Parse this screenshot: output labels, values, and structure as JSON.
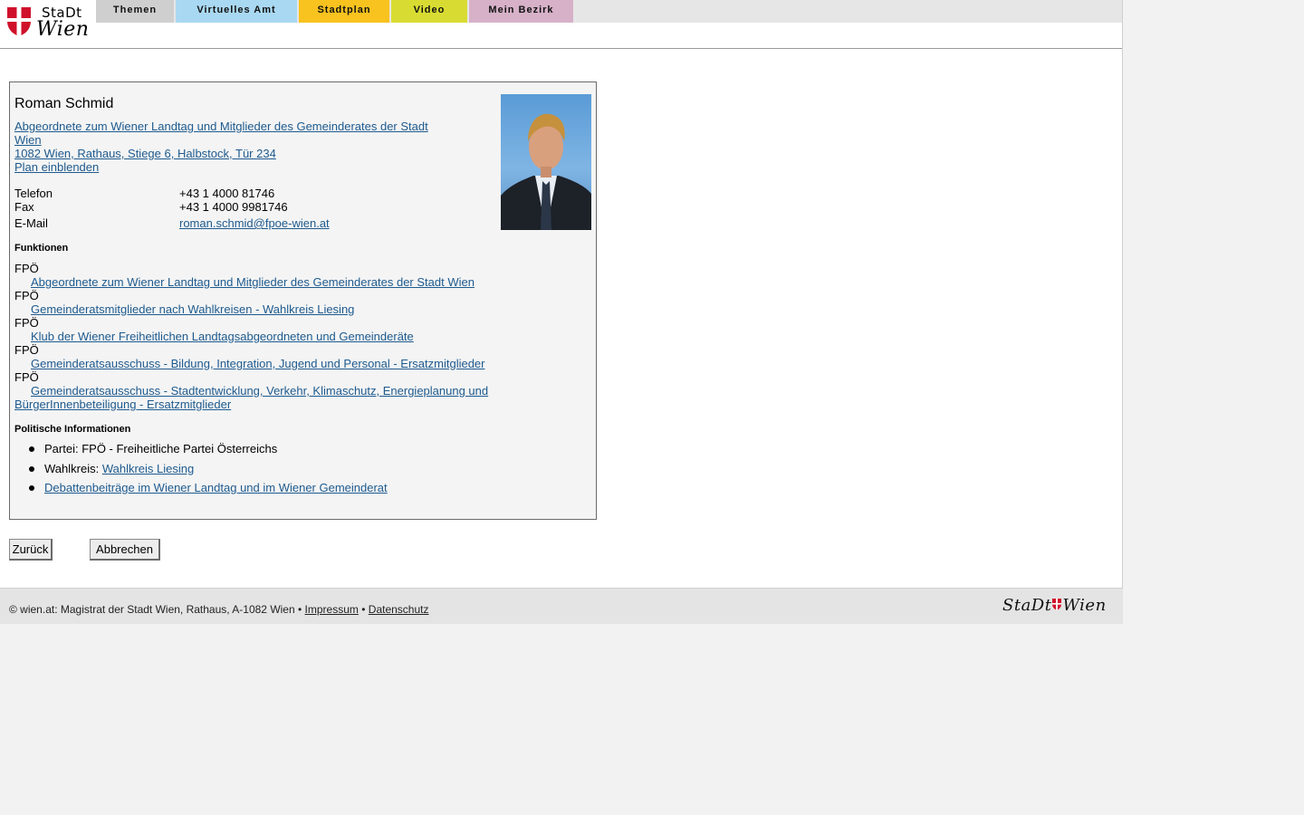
{
  "brand": {
    "line1": "StaDt",
    "line2": "Wien",
    "footer_logo_left": "StaDt",
    "footer_logo_right": "Wien"
  },
  "nav": {
    "tabs": [
      {
        "label": "Themen",
        "color": "#cfcfcf"
      },
      {
        "label": "Virtuelles Amt",
        "color": "#a9d8f2"
      },
      {
        "label": "Stadtplan",
        "color": "#f8c21f"
      },
      {
        "label": "Video",
        "color": "#d8dc32"
      },
      {
        "label": "Mein Bezirk",
        "color": "#d6b1c8"
      }
    ]
  },
  "person": {
    "name": "Roman Schmid",
    "role_line1": "Abgeordnete zum Wiener Landtag und Mitglieder des Gemeinderates der Stadt",
    "role_line2": "Wien ",
    "address": "1082 Wien, Rathaus, Stiege 6, Halbstock, Tür 234",
    "map_link": "Plan einblenden"
  },
  "contact": [
    {
      "label": "Telefon",
      "value": "+43 1 4000 81746"
    },
    {
      "label": "Fax",
      "value": "+43 1 4000 9981746"
    },
    {
      "label": "E-Mail",
      "value": "roman.schmid@fpoe-wien.at"
    }
  ],
  "functions": {
    "title": "Funktionen",
    "items": [
      {
        "party": "FPÖ",
        "text": "Abgeordnete zum Wiener Landtag und Mitglieder des Gemeinderates der Stadt Wien"
      },
      {
        "party": "FPÖ",
        "text": "Gemeinderatsmitglieder nach Wahlkreisen - Wahlkreis Liesing"
      },
      {
        "party": "FPÖ",
        "text": "Klub der Wiener Freiheitlichen Landtagsabgeordneten und Gemeinderäte"
      },
      {
        "party": "FPÖ",
        "text": "Gemeinderatsausschuss - Bildung, Integration, Jugend und Personal - Ersatzmitglieder"
      },
      {
        "party": "FPÖ",
        "text_line1": "Gemeinderatsausschuss - Stadtentwicklung, Verkehr, Klimaschutz, Energieplanung und",
        "text_line2": "BürgerInnenbeteiligung - Ersatzmitglieder"
      }
    ]
  },
  "political": {
    "title": "Politische Informationen",
    "party_label": "Partei:",
    "party_value": "FPÖ - Freiheitliche Partei Österreichs",
    "district_label": "Wahlkreis:",
    "district_link": "Wahlkreis Liesing",
    "debates_link": "Debattenbeiträge im Wiener Landtag und im Wiener Gemeinderat"
  },
  "buttons": {
    "back": "Zurück",
    "cancel": "Abbrechen"
  },
  "footer": {
    "copyright": "© wien.at: Magistrat der Stadt Wien, Rathaus, A-1082 Wien •",
    "impressum": "Impressum",
    "separator": "•",
    "privacy": "Datenschutz"
  }
}
